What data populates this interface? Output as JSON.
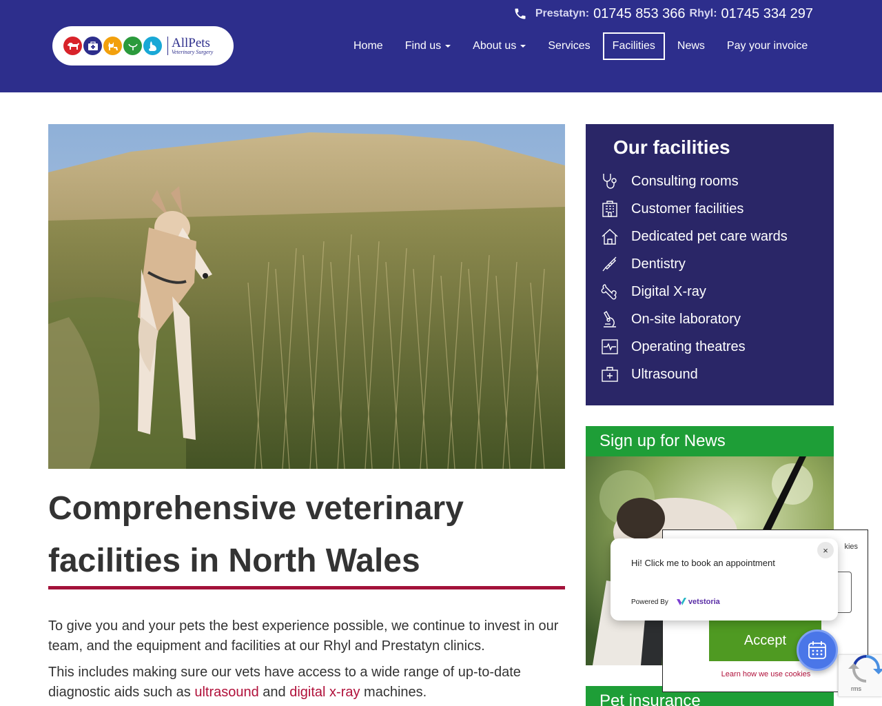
{
  "header": {
    "phones": [
      {
        "city": "Prestatyn:",
        "number": "01745 853 366"
      },
      {
        "city": "Rhyl:",
        "number": "01745 334 297"
      }
    ],
    "logo": {
      "brand": "AllPets",
      "tagline": "Veterinary Surgery"
    },
    "nav": [
      {
        "label": "Home",
        "dropdown": false,
        "active": false
      },
      {
        "label": "Find us",
        "dropdown": true,
        "active": false
      },
      {
        "label": "About us",
        "dropdown": true,
        "active": false
      },
      {
        "label": "Services",
        "dropdown": false,
        "active": false
      },
      {
        "label": "Facilities",
        "dropdown": false,
        "active": true
      },
      {
        "label": "News",
        "dropdown": false,
        "active": false
      },
      {
        "label": "Pay your invoice",
        "dropdown": false,
        "active": false
      }
    ]
  },
  "main": {
    "heading": "Comprehensive veterinary facilities in North Wales",
    "paragraph1": "To give you and your pets the best experience possible, we continue to invest in our team, and the equipment and facilities at our Rhyl and Prestatyn clinics.",
    "paragraph2": {
      "before": "This includes making sure our vets have access to a wide range of up-to-date diagnostic aids such as ",
      "link1": "ultrasound",
      "middle": " and ",
      "link2": "digital x-ray",
      "after": " machines."
    }
  },
  "sidebar": {
    "facilities_title": "Our facilities",
    "facilities": [
      {
        "label": "Consulting rooms",
        "icon": "stethoscope-icon"
      },
      {
        "label": "Customer facilities",
        "icon": "building-icon"
      },
      {
        "label": "Dedicated pet care wards",
        "icon": "house-icon"
      },
      {
        "label": "Dentistry",
        "icon": "dental-tool-icon"
      },
      {
        "label": "Digital X-ray",
        "icon": "bone-icon"
      },
      {
        "label": "On-site laboratory",
        "icon": "microscope-icon"
      },
      {
        "label": "Operating theatres",
        "icon": "monitor-icon"
      },
      {
        "label": "Ultrasound",
        "icon": "medical-case-icon"
      }
    ],
    "news_title": "Sign up for News",
    "pet_insurance_title": "Pet insurance"
  },
  "cookie": {
    "partial_text": "kies",
    "accept_label": "Accept",
    "learn_link": "Learn how we use cookies"
  },
  "recaptcha": {
    "partial_text": "rms"
  },
  "vetstoria": {
    "message": "Hi! Click me to book an appointment",
    "powered_by": "Powered By",
    "brand": "vetstoria",
    "close": "×"
  },
  "colors": {
    "header_bg": "#2d2e8c",
    "sidebar_bg": "#2a2667",
    "news_green": "#1e9e37",
    "accent_red": "#a3123a",
    "accept_green": "#4f9a22"
  }
}
